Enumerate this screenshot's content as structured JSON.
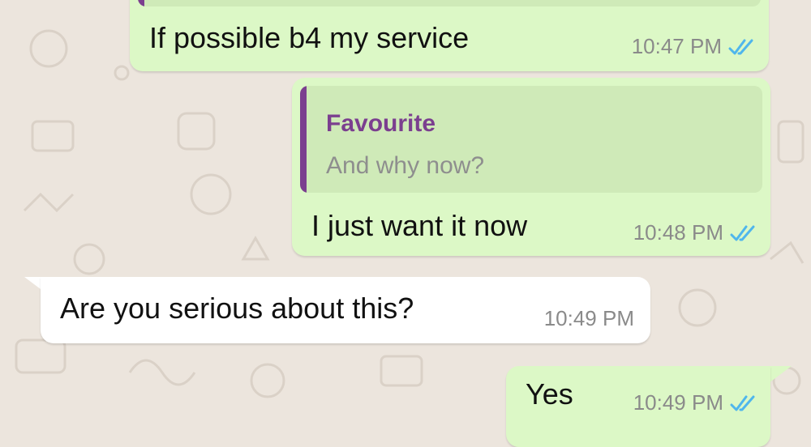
{
  "colors": {
    "outgoing_bubble": "#dcf8c6",
    "incoming_bubble": "#ffffff",
    "quote_accent": "#7b3f8f",
    "read_tick": "#4fb6ec",
    "background": "#ece5dd"
  },
  "messages": [
    {
      "direction": "outgoing",
      "text": "If possible b4 my service",
      "time": "10:47 PM",
      "status_icon": "double-check-read-icon"
    },
    {
      "direction": "outgoing",
      "quote": {
        "author": "Favourite",
        "text": "And why now?"
      },
      "text": "I just want it now",
      "time": "10:48 PM",
      "status_icon": "double-check-read-icon"
    },
    {
      "direction": "incoming",
      "text": "Are you serious about this?",
      "time": "10:49 PM"
    },
    {
      "direction": "outgoing",
      "text": "Yes",
      "time": "10:49 PM",
      "status_icon": "double-check-read-icon"
    }
  ]
}
